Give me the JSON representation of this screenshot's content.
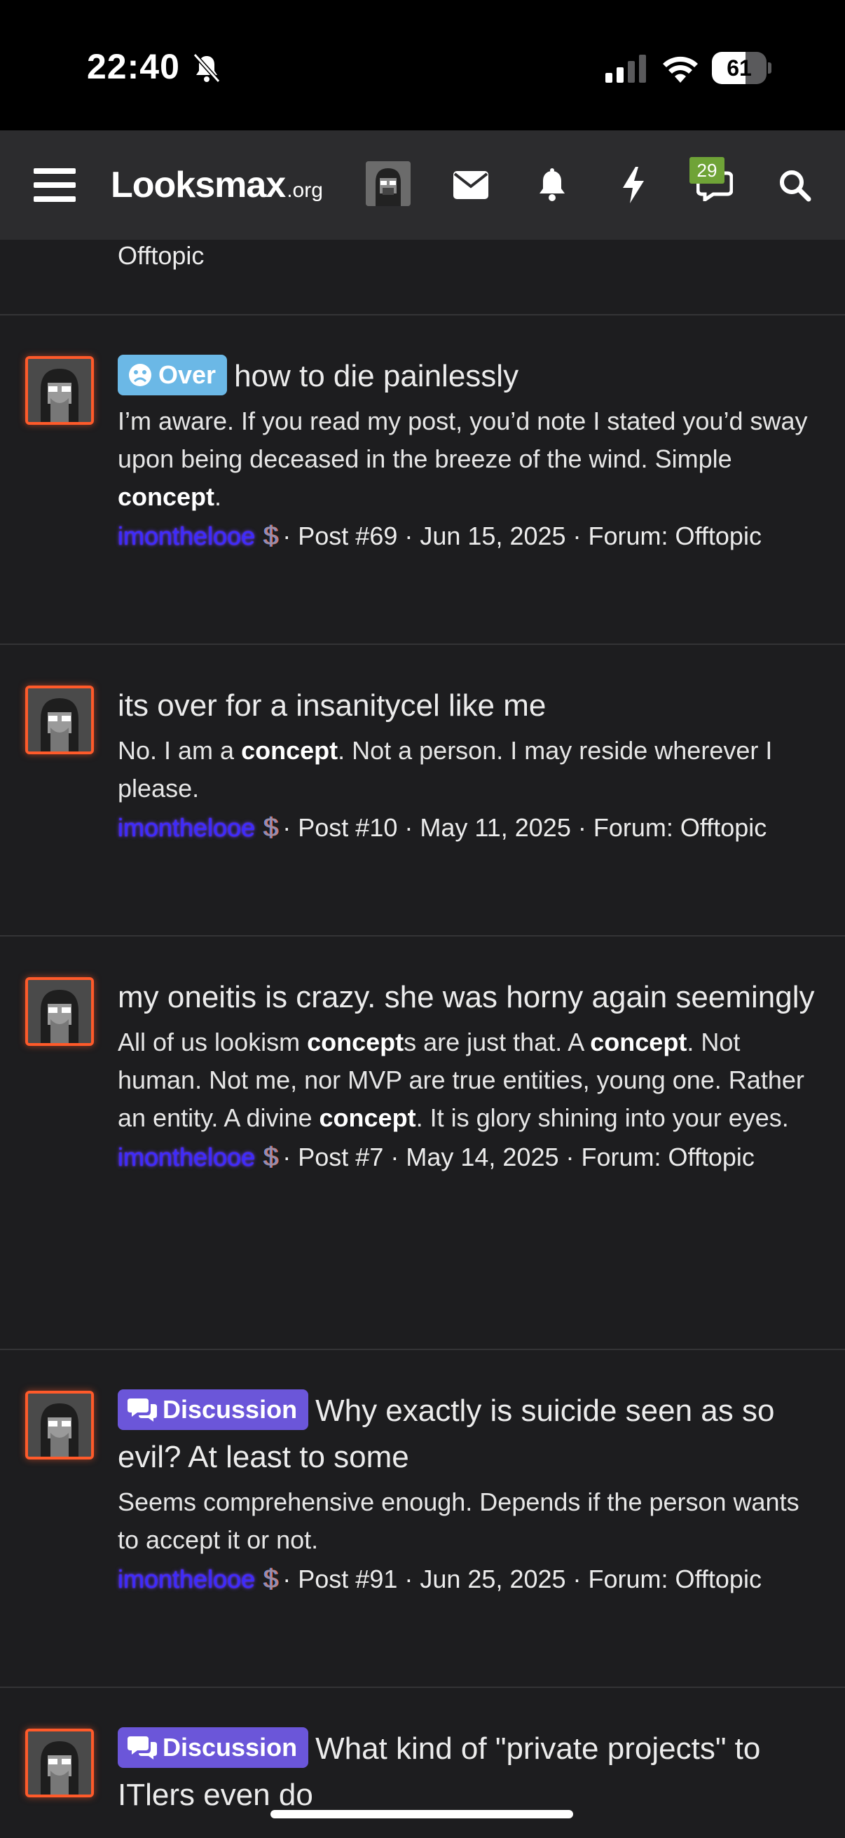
{
  "status": {
    "time": "22:40",
    "battery": "61",
    "battery_level": 0.61
  },
  "header": {
    "logo_main": "Looksmax",
    "logo_org": ".org",
    "badge_count": "29",
    "icons": [
      "menu-icon",
      "mail-icon",
      "bell-icon",
      "bolt-icon",
      "chat-icon",
      "search-icon"
    ]
  },
  "feed": {
    "top_fragment": "Offtopic",
    "items": [
      {
        "prefix": "Over",
        "title": "how to die painlessly",
        "snippet_parts": [
          "I’m aware. If you read my post, you’d note I stated you’d sway upon being deceased in the breeze of the wind. Simple ",
          "concept",
          "."
        ],
        "username": "imonthelooe",
        "meta": "· Post #69 · Jun 15, 2025 · Forum: Offtopic"
      },
      {
        "prefix": "",
        "title": "its over for a insanitycel like me",
        "snippet_parts": [
          "No. I am a ",
          "concept",
          ". Not a person. I may reside wherever I please."
        ],
        "username": "imonthelooe",
        "meta": "· Post #10 · May 11, 2025 · Forum: Offtopic"
      },
      {
        "prefix": "",
        "title": "my oneitis is crazy. she was horny again seemingly",
        "snippet_parts": [
          "All of us lookism ",
          "concept",
          "s are just that. A ",
          "concept",
          ". Not human. Not me, nor MVP are true entities, young one. Rather an entity. A divine ",
          "concept",
          ". It is glory shining into your eyes."
        ],
        "username": "imonthelooe",
        "meta": "· Post #7 · May 14, 2025 · Forum: Offtopic"
      },
      {
        "prefix": "Discussion",
        "title": "Why exactly is suicide seen as so evil? At least to some",
        "snippet_parts": [
          "Seems comprehensive enough. Depends if the person wants to accept it or not."
        ],
        "username": "imonthelooe",
        "meta": "· Post #91 · Jun 25, 2025 · Forum: Offtopic"
      },
      {
        "prefix": "Discussion",
        "title": "What kind of \"private projects\" to ITlers even do",
        "snippet_parts": [],
        "username": "",
        "meta": ""
      }
    ]
  },
  "colors": {
    "accent_over": "#6bb8e6",
    "accent_discussion": "#6b56d9",
    "avatar_border": "#ff5a2a",
    "badge": "#6fa337"
  }
}
